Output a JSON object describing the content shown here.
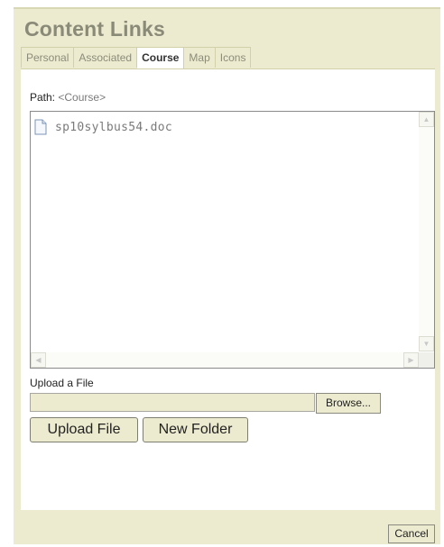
{
  "dialog": {
    "title": "Content Links"
  },
  "tabs": [
    {
      "label": "Personal"
    },
    {
      "label": "Associated"
    },
    {
      "label": "Course"
    },
    {
      "label": "Map"
    },
    {
      "label": "Icons"
    }
  ],
  "active_tab": "Course",
  "path": {
    "label": "Path:",
    "value": "<Course>"
  },
  "files": [
    {
      "name": "sp10sylbus54.doc",
      "icon": "document-icon"
    }
  ],
  "upload": {
    "label": "Upload a File",
    "field_value": "",
    "browse_label": "Browse...",
    "upload_button": "Upload File",
    "new_folder_button": "New Folder"
  },
  "footer": {
    "cancel_label": "Cancel"
  },
  "colors": {
    "panel_bg": "#ecebcf",
    "title": "#8a8a78",
    "tab_border": "#d2d0a8"
  }
}
